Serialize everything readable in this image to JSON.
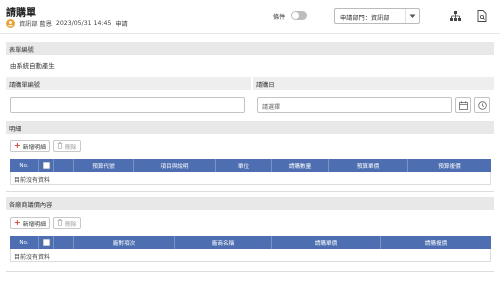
{
  "header": {
    "title": "請購單",
    "user": "資訊部 藍恩",
    "datetime": "2023/05/31 14:45",
    "status": "申請",
    "condition_label": "條件",
    "dept_select": "申請部門：資訊部"
  },
  "form": {
    "number_section": "表單編號",
    "number_value": "由系統自動產生",
    "req_no_label": "請購單編號",
    "req_date_label": "請購日",
    "req_date_placeholder": "請選擇"
  },
  "details": {
    "section_title": "明細",
    "add_label": "新增明細",
    "delete_label": "刪除",
    "columns": [
      "No.",
      "",
      "",
      "預算代號",
      "項目與說明",
      "單位",
      "請購數量",
      "預算單價",
      "預算複價"
    ],
    "empty_text": "目前沒有資料"
  },
  "vendors": {
    "section_title": "各廠商議價內容",
    "add_label": "新增明細",
    "delete_label": "刪除",
    "columns": [
      "No.",
      "",
      "",
      "廠對項次",
      "廠商名稱",
      "請購單價",
      "請購複價"
    ],
    "empty_text": "目前沒有資料"
  },
  "colors": {
    "table_header": "#4d6eb0",
    "section_bg": "#e8e8e8",
    "add_plus": "#d8402b",
    "avatar": "#e8a33a"
  }
}
